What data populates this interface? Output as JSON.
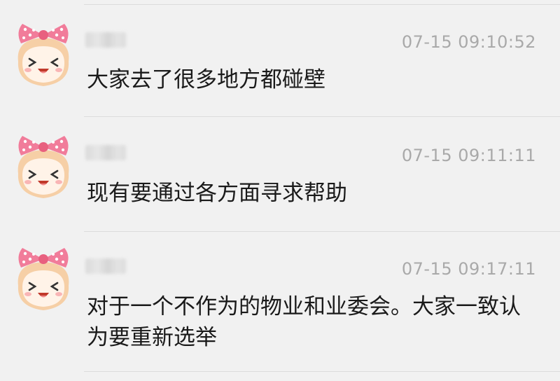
{
  "messages": [
    {
      "sender_name": "",
      "timestamp": "07-15 09:10:52",
      "text": "大家去了很多地方都碰壁",
      "avatar_icon": "pink-bow-girl-avatar-icon"
    },
    {
      "sender_name": "",
      "timestamp": "07-15 09:11:11",
      "text": "现有要通过各方面寻求帮助",
      "avatar_icon": "pink-bow-girl-avatar-icon"
    },
    {
      "sender_name": "",
      "timestamp": "07-15 09:17:11",
      "text": "对于一个不作为的物业和业委会。大家一致认为要重新选举",
      "avatar_icon": "pink-bow-girl-avatar-icon"
    }
  ],
  "colors": {
    "background": "#f1f1f1",
    "timestamp": "#a9a9a9",
    "text": "#1a1a1a",
    "bow": "#f17c9a",
    "bow_dots": "#ffffff",
    "face": "#fff3e8"
  }
}
